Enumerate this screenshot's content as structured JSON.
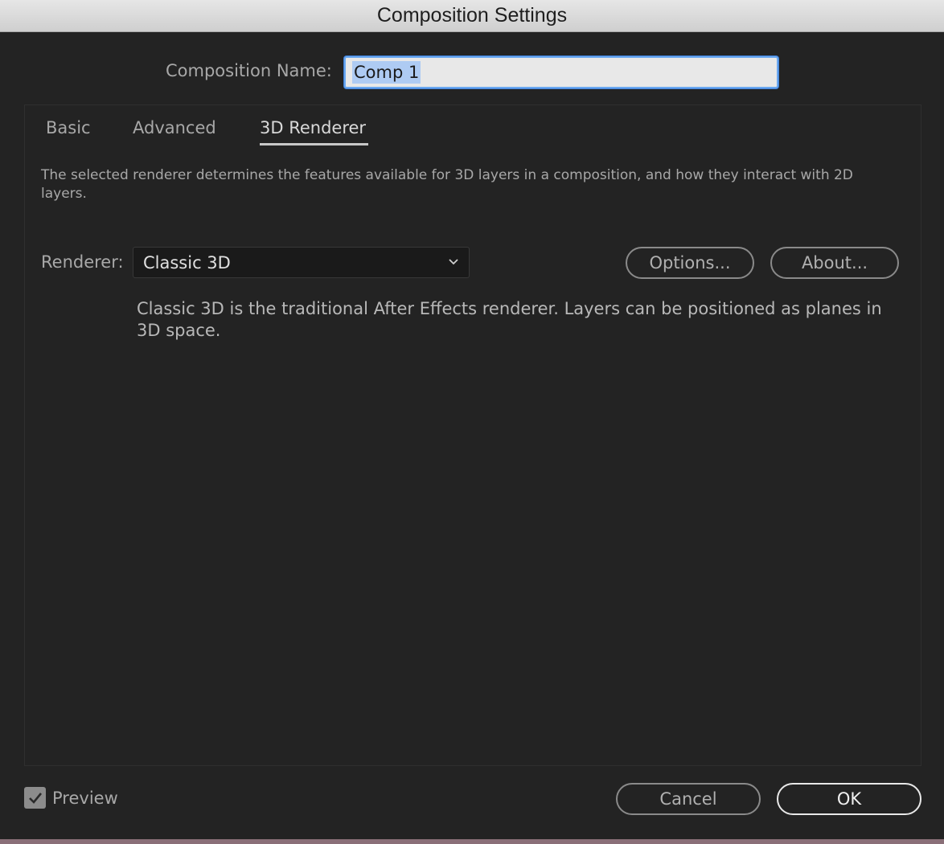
{
  "window": {
    "title": "Composition Settings"
  },
  "composition": {
    "name_label": "Composition Name:",
    "name_value": "Comp 1"
  },
  "tabs": [
    {
      "label": "Basic",
      "active": false
    },
    {
      "label": "Advanced",
      "active": false
    },
    {
      "label": "3D Renderer",
      "active": true
    }
  ],
  "renderer_tab": {
    "description": "The selected renderer determines the features available for 3D layers in a composition, and how they interact with 2D layers.",
    "renderer_label": "Renderer:",
    "renderer_selected": "Classic 3D",
    "options_button": "Options...",
    "about_button": "About...",
    "renderer_info": "Classic 3D is the traditional After Effects renderer. Layers can be positioned as planes in 3D space."
  },
  "footer": {
    "preview_label": "Preview",
    "preview_checked": true,
    "cancel_label": "Cancel",
    "ok_label": "OK"
  },
  "icons": {
    "dropdown": "chevron-down-icon",
    "check": "checkmark-icon"
  },
  "colors": {
    "panel_bg": "#232323",
    "input_focus": "#6aa8f0",
    "selection": "#aecbf3"
  }
}
